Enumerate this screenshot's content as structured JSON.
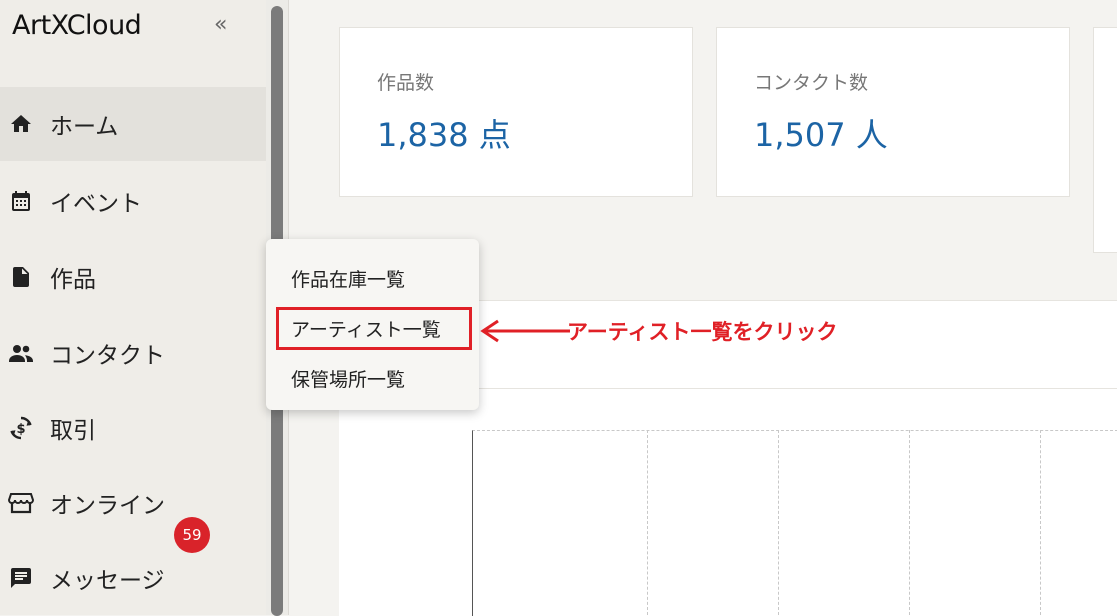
{
  "app": {
    "logo": "ArtXCloud",
    "collapse_icon": "double-chevron-left-icon"
  },
  "sidebar": {
    "items": [
      {
        "label": "ホーム",
        "icon": "home-icon",
        "active": true
      },
      {
        "label": "イベント",
        "icon": "calendar-icon"
      },
      {
        "label": "作品",
        "icon": "document-icon"
      },
      {
        "label": "コンタクト",
        "icon": "people-icon"
      },
      {
        "label": "取引",
        "icon": "currency-exchange-icon"
      },
      {
        "label": "オンライン",
        "icon": "storefront-icon"
      },
      {
        "label": "メッセージ",
        "icon": "message-icon",
        "badge": "59"
      }
    ]
  },
  "stats": [
    {
      "label": "作品数",
      "value": "1,838 点"
    },
    {
      "label": "コンタクト数",
      "value": "1,507 人"
    }
  ],
  "submenu": {
    "items": [
      "作品在庫一覧",
      "アーティスト一覧",
      "保管場所一覧"
    ],
    "highlighted_index": 1
  },
  "annotation": {
    "text": "アーティスト一覧をクリック",
    "color": "#e02026"
  },
  "colors": {
    "accent": "#1c64a5",
    "badge": "#d9232a"
  }
}
